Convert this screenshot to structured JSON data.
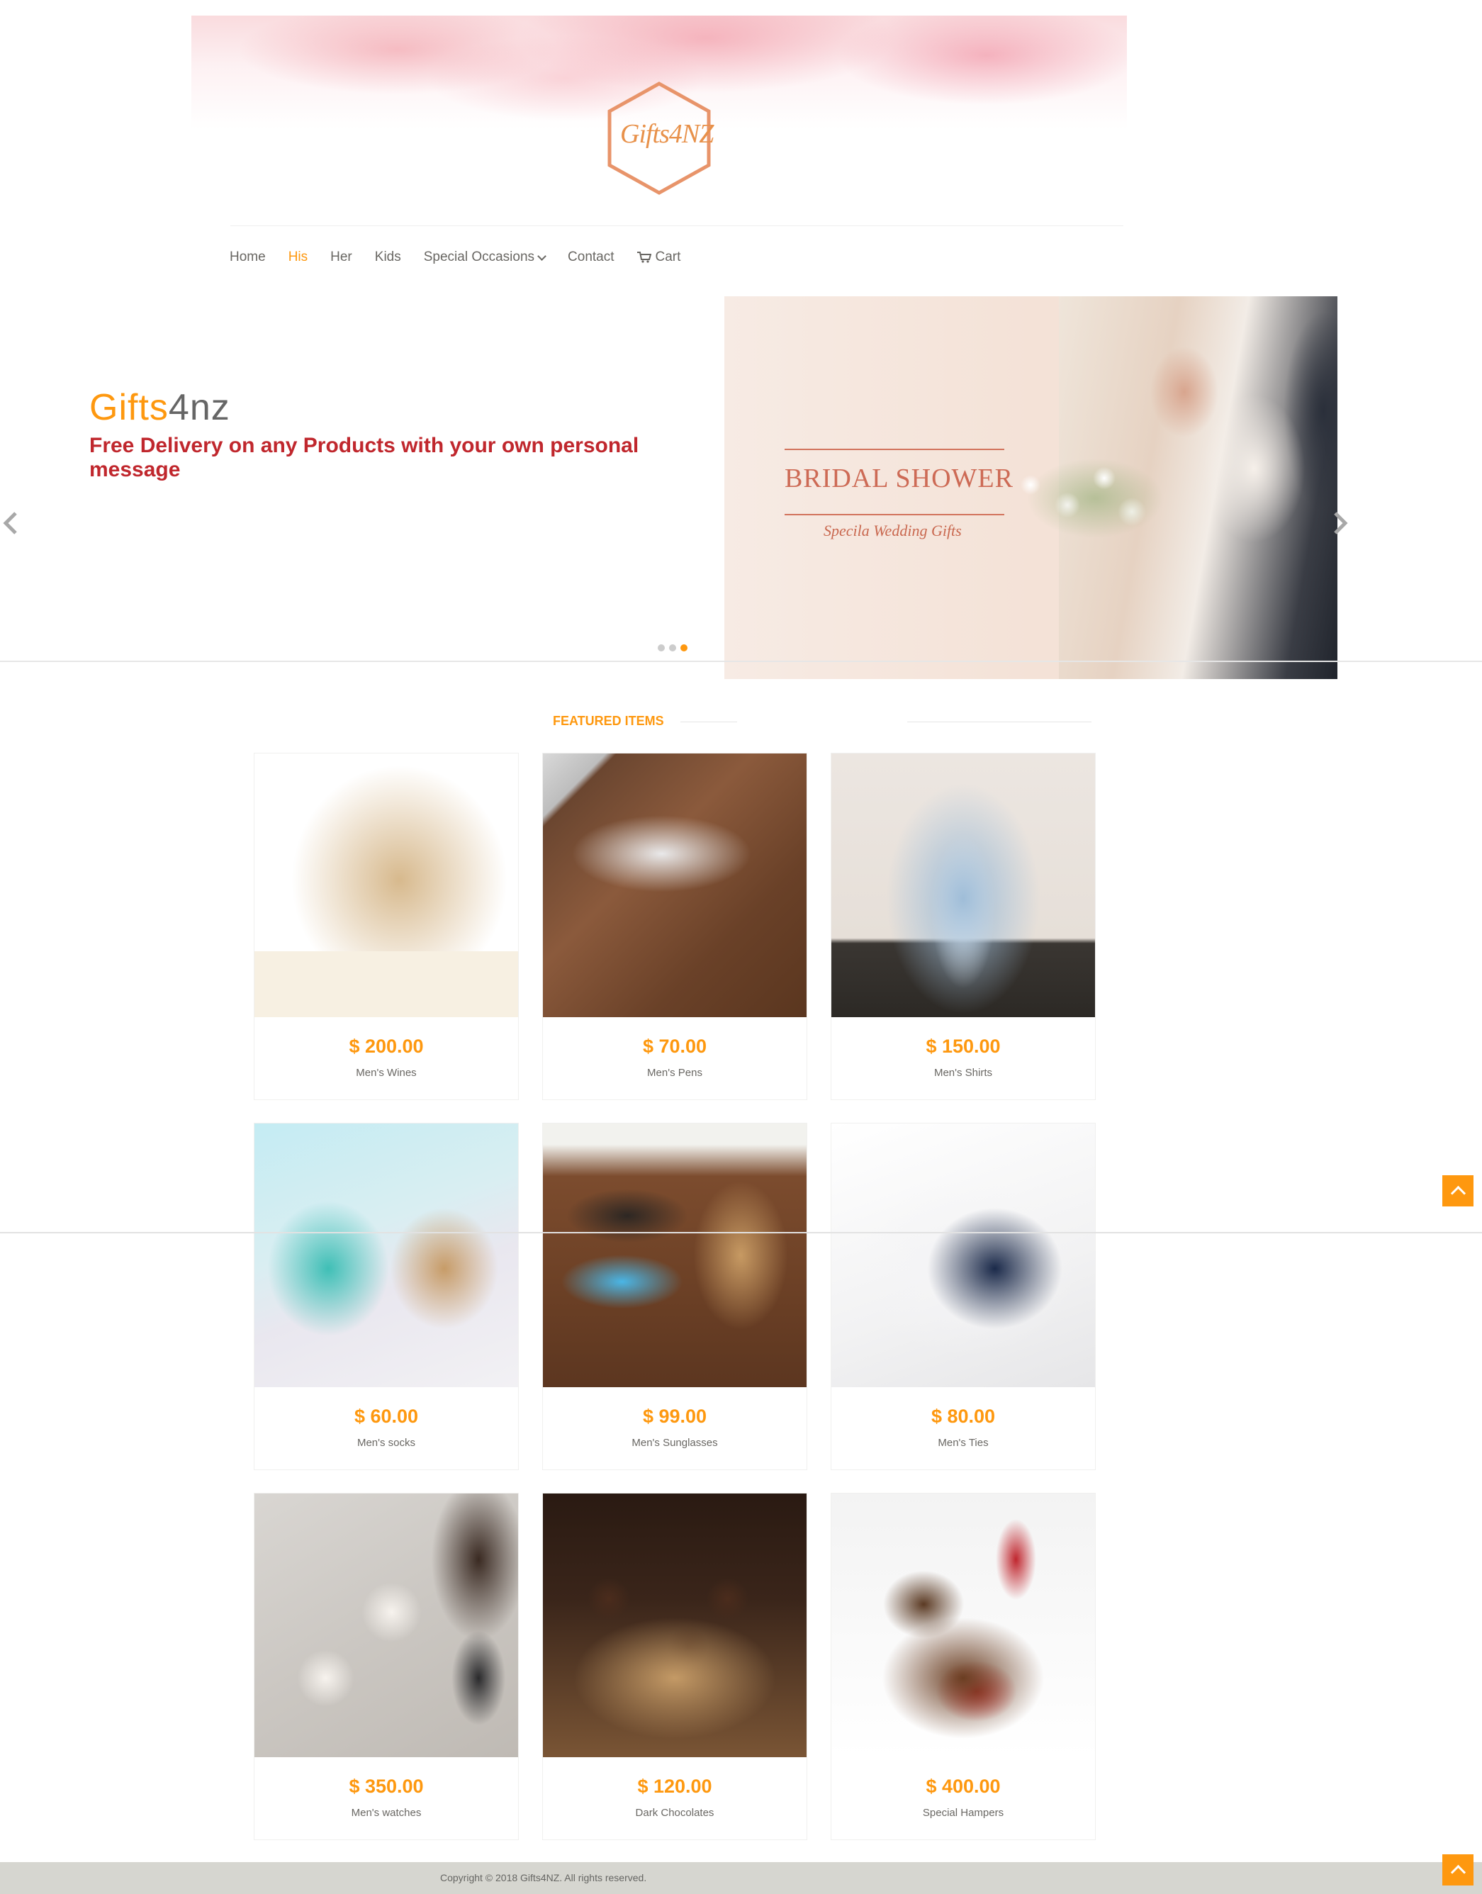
{
  "header": {
    "logo_text": "Gifts4NZ"
  },
  "nav": {
    "items": [
      {
        "label": "Home"
      },
      {
        "label": "His"
      },
      {
        "label": "Her"
      },
      {
        "label": "Kids"
      },
      {
        "label": "Special Occasions"
      },
      {
        "label": "Contact"
      },
      {
        "label": "Cart"
      }
    ],
    "active": "His"
  },
  "slider": {
    "brand_part1": "Gifts",
    "brand_part2": "4nz",
    "tagline": "Free Delivery on any Products with your own personal message",
    "slide_title": "BRIDAL SHOWER",
    "slide_subtitle": "Specila Wedding Gifts",
    "dots_count": 3,
    "active_dot": 3
  },
  "featured": {
    "title": "FEATURED ITEMS",
    "products": [
      {
        "price": "$ 200.00",
        "name": "Men's Wines"
      },
      {
        "price": "$ 70.00",
        "name": "Men's Pens"
      },
      {
        "price": "$ 150.00",
        "name": "Men's Shirts"
      },
      {
        "price": "$ 60.00",
        "name": "Men's socks"
      },
      {
        "price": "$ 99.00",
        "name": "Men's Sunglasses"
      },
      {
        "price": "$ 80.00",
        "name": "Men's Ties"
      },
      {
        "price": "$ 350.00",
        "name": "Men's watches"
      },
      {
        "price": "$ 120.00",
        "name": "Dark Chocolates"
      },
      {
        "price": "$ 400.00",
        "name": "Special Hampers"
      }
    ]
  },
  "footer": {
    "copyright": "Copyright © 2018 Gifts4NZ. All rights reserved."
  },
  "colors": {
    "accent": "#fe980f",
    "tagline": "#c0272d",
    "text": "#696763",
    "footer_bg": "#d6d6d0"
  }
}
